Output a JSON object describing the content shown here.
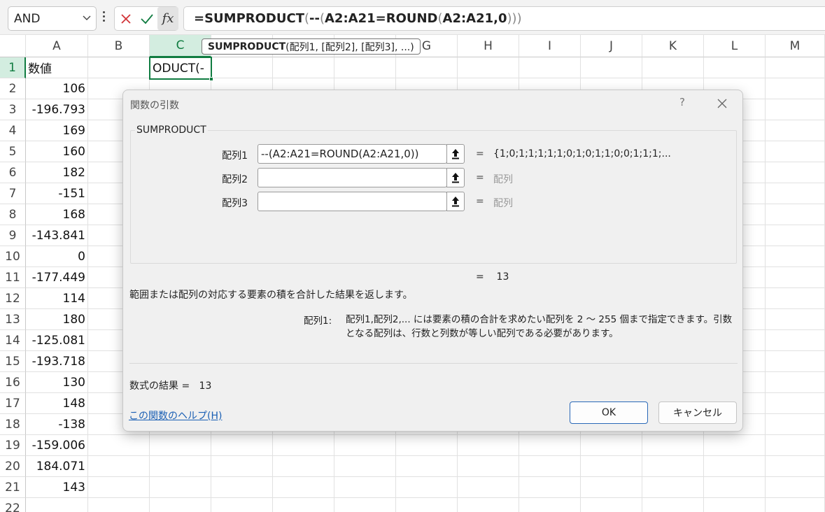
{
  "formula_bar": {
    "name_box": "AND",
    "formula_prefix": "=SUMPRODUCT",
    "formula_open": "(",
    "formula_mid": "--",
    "formula_open2": "(",
    "formula_body": "A2:A21=ROUND",
    "formula_open3": "(",
    "formula_body2": "A2:A21,0",
    "formula_close": ")))"
  },
  "tooltip": {
    "fn": "SUMPRODUCT",
    "args": "(配列1, [配列2], [配列3], ...)"
  },
  "columns": [
    "A",
    "B",
    "C",
    "D",
    "E",
    "F",
    "G",
    "H",
    "I",
    "J",
    "K",
    "L",
    "M"
  ],
  "rows": [
    "1",
    "2",
    "3",
    "4",
    "5",
    "6",
    "7",
    "8",
    "9",
    "10",
    "11",
    "12",
    "13",
    "14",
    "15",
    "16",
    "17",
    "18",
    "19",
    "20",
    "21",
    "22"
  ],
  "cells": {
    "A1": "数値",
    "A": [
      "106",
      "-196.793",
      "169",
      "160",
      "182",
      "-151",
      "168",
      "-143.841",
      "0",
      "-177.449",
      "114",
      "180",
      "-125.081",
      "-193.718",
      "130",
      "148",
      "-138",
      "-159.006",
      "184.071",
      "143"
    ],
    "C1_editing": "ODUCT(-"
  },
  "dialog": {
    "title": "関数の引数",
    "help": "?",
    "function_name": "SUMPRODUCT",
    "args": [
      {
        "label": "配列1",
        "value": "--(A2:A21=ROUND(A2:A21,0))",
        "eq": "=",
        "result": "{1;0;1;1;1;1;1;0;1;0;1;1;0;0;1;1;1;..."
      },
      {
        "label": "配列2",
        "value": "",
        "eq": "=",
        "result": "配列"
      },
      {
        "label": "配列3",
        "value": "",
        "eq": "=",
        "result": "配列"
      }
    ],
    "result_line": "=    13",
    "description": "範囲または配列の対応する要素の積を合計した結果を返します。",
    "arg_desc_label": "配列1:",
    "arg_desc": "配列1,配列2,... には要素の積の合計を求めたい配列を 2 〜 255 個まで指定できます。引数となる配列は、行数と列数が等しい配列である必要があります。",
    "formula_result": "数式の結果 =   13",
    "help_link": "この関数のヘルプ(H)",
    "ok": "OK",
    "cancel": "キャンセル"
  }
}
